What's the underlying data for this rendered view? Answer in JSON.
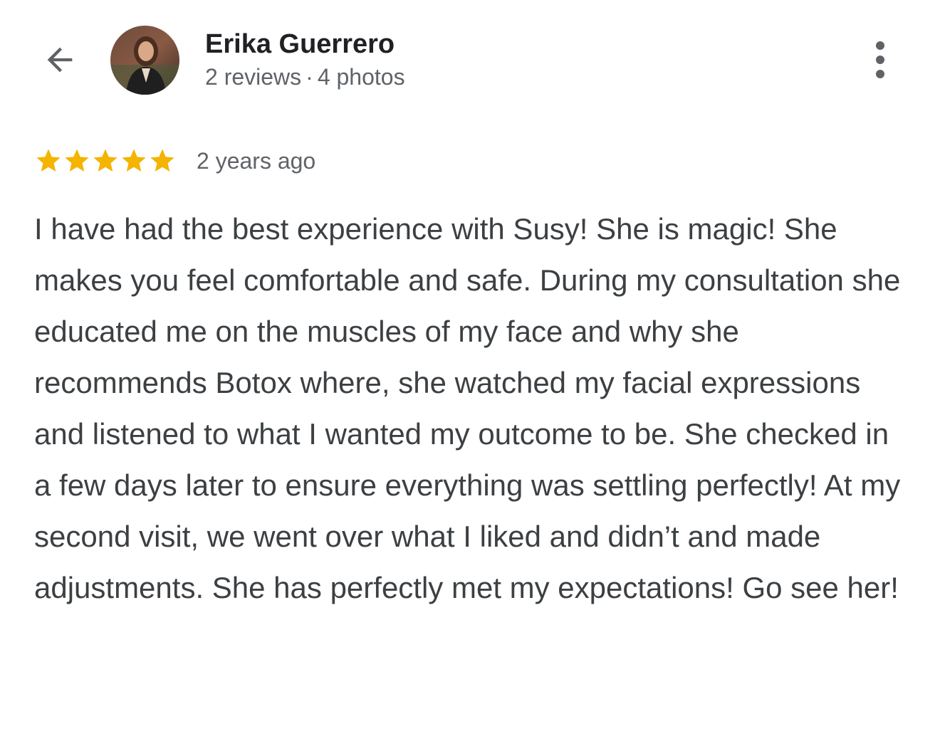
{
  "reviewer": {
    "name": "Erika Guerrero",
    "reviews_count": "2 reviews",
    "separator": "·",
    "photos_count": "4 photos"
  },
  "review": {
    "rating": 5,
    "rating_max": 5,
    "date": "2 years ago",
    "text": "I have had the best experience with Susy! She is magic! She makes you feel comfortable and safe. During my consultation she educated me on the muscles of my face and why she recommends Botox where, she watched my facial expressions and listened to what I wanted my outcome to be. She checked in a few days later to ensure everything was settling perfectly! At my second visit, we went over what I liked and didn’t and made adjustments. She has perfectly met my expectations! Go see her!"
  },
  "icons": {
    "back": "arrow-back-icon",
    "more": "more-vert-icon",
    "star": "star-icon"
  },
  "colors": {
    "star": "#f4b400",
    "name": "#202124",
    "secondary_text": "#5f6368",
    "body_text": "#3c4043",
    "icon": "#5f6368"
  }
}
